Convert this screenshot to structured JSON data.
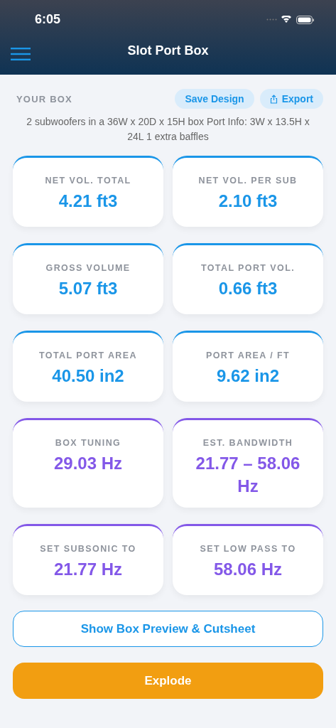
{
  "status_bar": {
    "time": "6:05"
  },
  "nav": {
    "title": "Slot Port Box"
  },
  "section": {
    "label": "YOUR BOX",
    "buttons": [
      {
        "label": "Save Design",
        "kind": "plain"
      },
      {
        "label": "Export",
        "kind": "share"
      }
    ]
  },
  "description": "2 subwoofers in a 36W x 20D x 15H box Port Info: 3W x 13.5H x 24L 1 extra baffles",
  "cards": [
    {
      "label": "NET VOL. TOTAL",
      "value": "4.21 ft3",
      "color": "#1a96e8"
    },
    {
      "label": "NET VOL. PER SUB",
      "value": "2.10 ft3",
      "color": "#1a96e8"
    },
    {
      "label": "GROSS VOLUME",
      "value": "5.07 ft3",
      "color": "#1a96e8"
    },
    {
      "label": "TOTAL PORT VOL.",
      "value": "0.66 ft3",
      "color": "#1a96e8"
    },
    {
      "label": "TOTAL PORT AREA",
      "value": "40.50 in2",
      "color": "#1a96e8"
    },
    {
      "label": "PORT AREA / FT",
      "value": "9.62 in2",
      "color": "#1a96e8"
    },
    {
      "label": "BOX TUNING",
      "value": "29.03 Hz",
      "color": "#8358e8"
    },
    {
      "label": "EST. BANDWIDTH",
      "value": "21.77 – 58.06 Hz",
      "color": "#8358e8"
    },
    {
      "label": "SET SUBSONIC TO",
      "value": "21.77 Hz",
      "color": "#8358e8"
    },
    {
      "label": "SET LOW PASS TO",
      "value": "58.06 Hz",
      "color": "#8358e8"
    }
  ],
  "actions": [
    {
      "label": "Show Box Preview & Cutsheet",
      "kind": "outline"
    },
    {
      "label": "Explode",
      "kind": "filled"
    }
  ]
}
